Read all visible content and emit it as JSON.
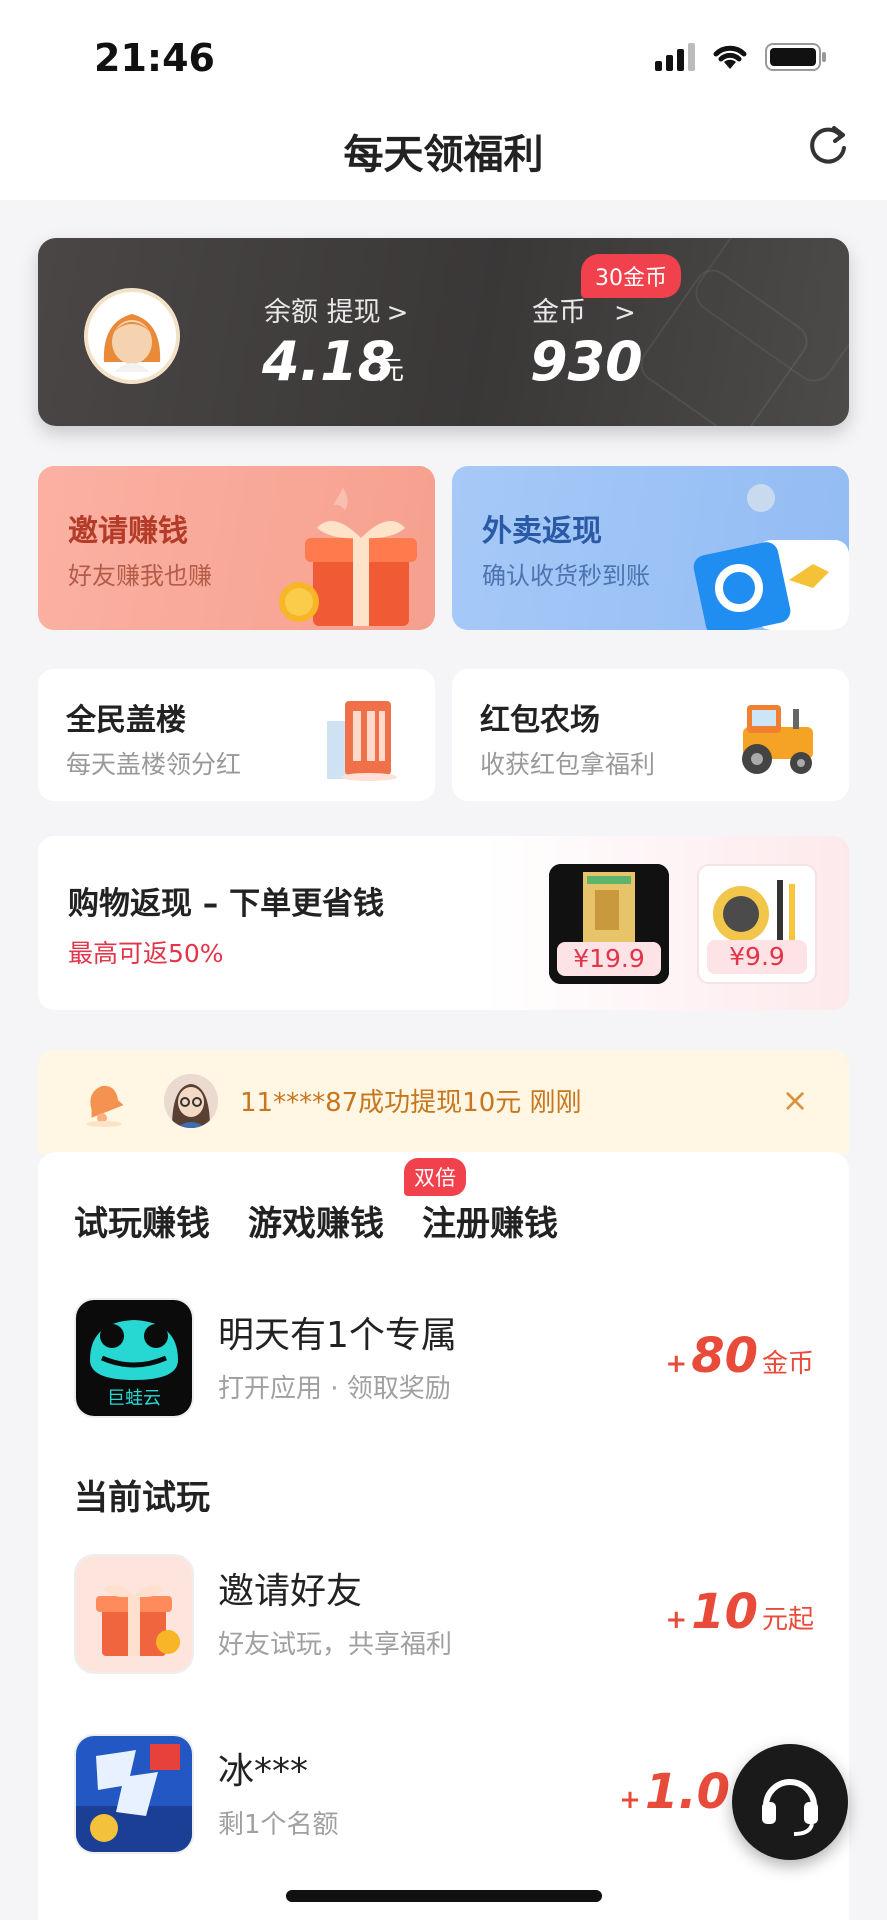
{
  "status": {
    "time": "21:46"
  },
  "nav": {
    "title": "每天领福利"
  },
  "balance": {
    "balance_label": "余额 提现",
    "balance_value": "4.18",
    "balance_unit": "元",
    "coin_label": "金币",
    "coin_value": "930",
    "coin_badge": "30金币",
    "arrow": ">"
  },
  "features": [
    {
      "title": "邀请赚钱",
      "subtitle": "好友赚我也赚"
    },
    {
      "title": "外卖返现",
      "subtitle": "确认收货秒到账"
    }
  ],
  "small_cards": [
    {
      "title": "全民盖楼",
      "subtitle": "每天盖楼领分红"
    },
    {
      "title": "红包农场",
      "subtitle": "收获红包拿福利"
    }
  ],
  "shopping": {
    "title": "购物返现 – 下单更省钱",
    "subtitle": "最高可返50%",
    "products": [
      {
        "price": "¥19.9"
      },
      {
        "price": "¥9.9"
      }
    ]
  },
  "notice": {
    "text": "11****87成功提现10元 刚刚",
    "close": "×"
  },
  "tabs": {
    "items": [
      {
        "label": "试玩赚钱"
      },
      {
        "label": "游戏赚钱"
      },
      {
        "label": "注册赚钱"
      }
    ],
    "badge": "双倍"
  },
  "tasks": [
    {
      "name": "明天有1个专属",
      "desc": "打开应用 · 领取奖励",
      "plus": "+",
      "reward": "80",
      "unit": "金币",
      "icon_text": "巨蛙云"
    },
    {
      "name": "邀请好友",
      "desc": "好友试玩，共享福利",
      "plus": "+",
      "reward": "10",
      "unit": "元起"
    },
    {
      "name": "冰***",
      "desc": "剩1个名额",
      "plus": "+",
      "reward": "1.0",
      "unit": ""
    }
  ],
  "section": {
    "current_trial": "当前试玩"
  },
  "colors": {
    "accent": "#f0414d",
    "reward": "#e84b3a",
    "card_dark": "#3a3737"
  }
}
